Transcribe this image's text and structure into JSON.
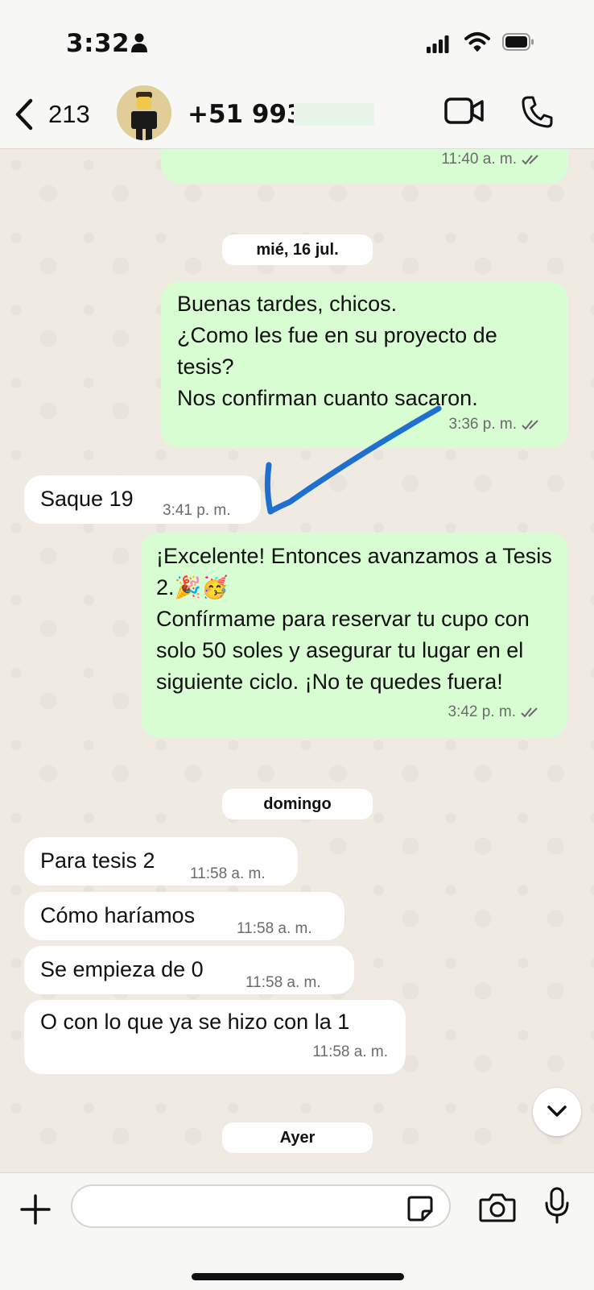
{
  "status_bar": {
    "time": "3:32"
  },
  "header": {
    "back_count": "213",
    "contact_name": "+51 993 "
  },
  "messages": [
    {
      "text": "",
      "time": "11:40 a. m."
    },
    {
      "date": "mié, 16 jul."
    },
    {
      "text": "Buenas tardes, chicos.\n¿Como les fue en su proyecto de tesis?\nNos confirman cuanto sacaron.",
      "time": "3:36 p. m."
    },
    {
      "text": "Saque 19",
      "time": "3:41 p. m."
    },
    {
      "text": "¡Excelente! Entonces avanzamos a Tesis 2.🎉🥳\nConfírmame para reservar tu cupo con solo 50 soles y asegurar tu lugar en el siguiente ciclo. ¡No te quedes fuera!",
      "time": "3:42 p. m."
    },
    {
      "date": "domingo"
    },
    {
      "text": "Para tesis 2",
      "time": "11:58 a. m."
    },
    {
      "text": "Cómo haríamos",
      "time": "11:58 a. m."
    },
    {
      "text": "Se empieza de 0",
      "time": "11:58 a. m."
    },
    {
      "text": "O con lo que ya se hizo con la 1",
      "time": "11:58 a. m."
    },
    {
      "date": "Ayer"
    }
  ],
  "colors": {
    "outgoing": "#d9fdd3",
    "incoming": "#ffffff",
    "background": "#efeae2",
    "annotation": "#1f6fd1"
  },
  "icons": [
    "person-icon",
    "signal-icon",
    "wifi-icon",
    "battery-icon",
    "chevron-left-icon",
    "video-camera-icon",
    "phone-icon",
    "double-check-icon",
    "chevron-down-icon",
    "plus-icon",
    "sticker-icon",
    "camera-icon",
    "microphone-icon"
  ]
}
